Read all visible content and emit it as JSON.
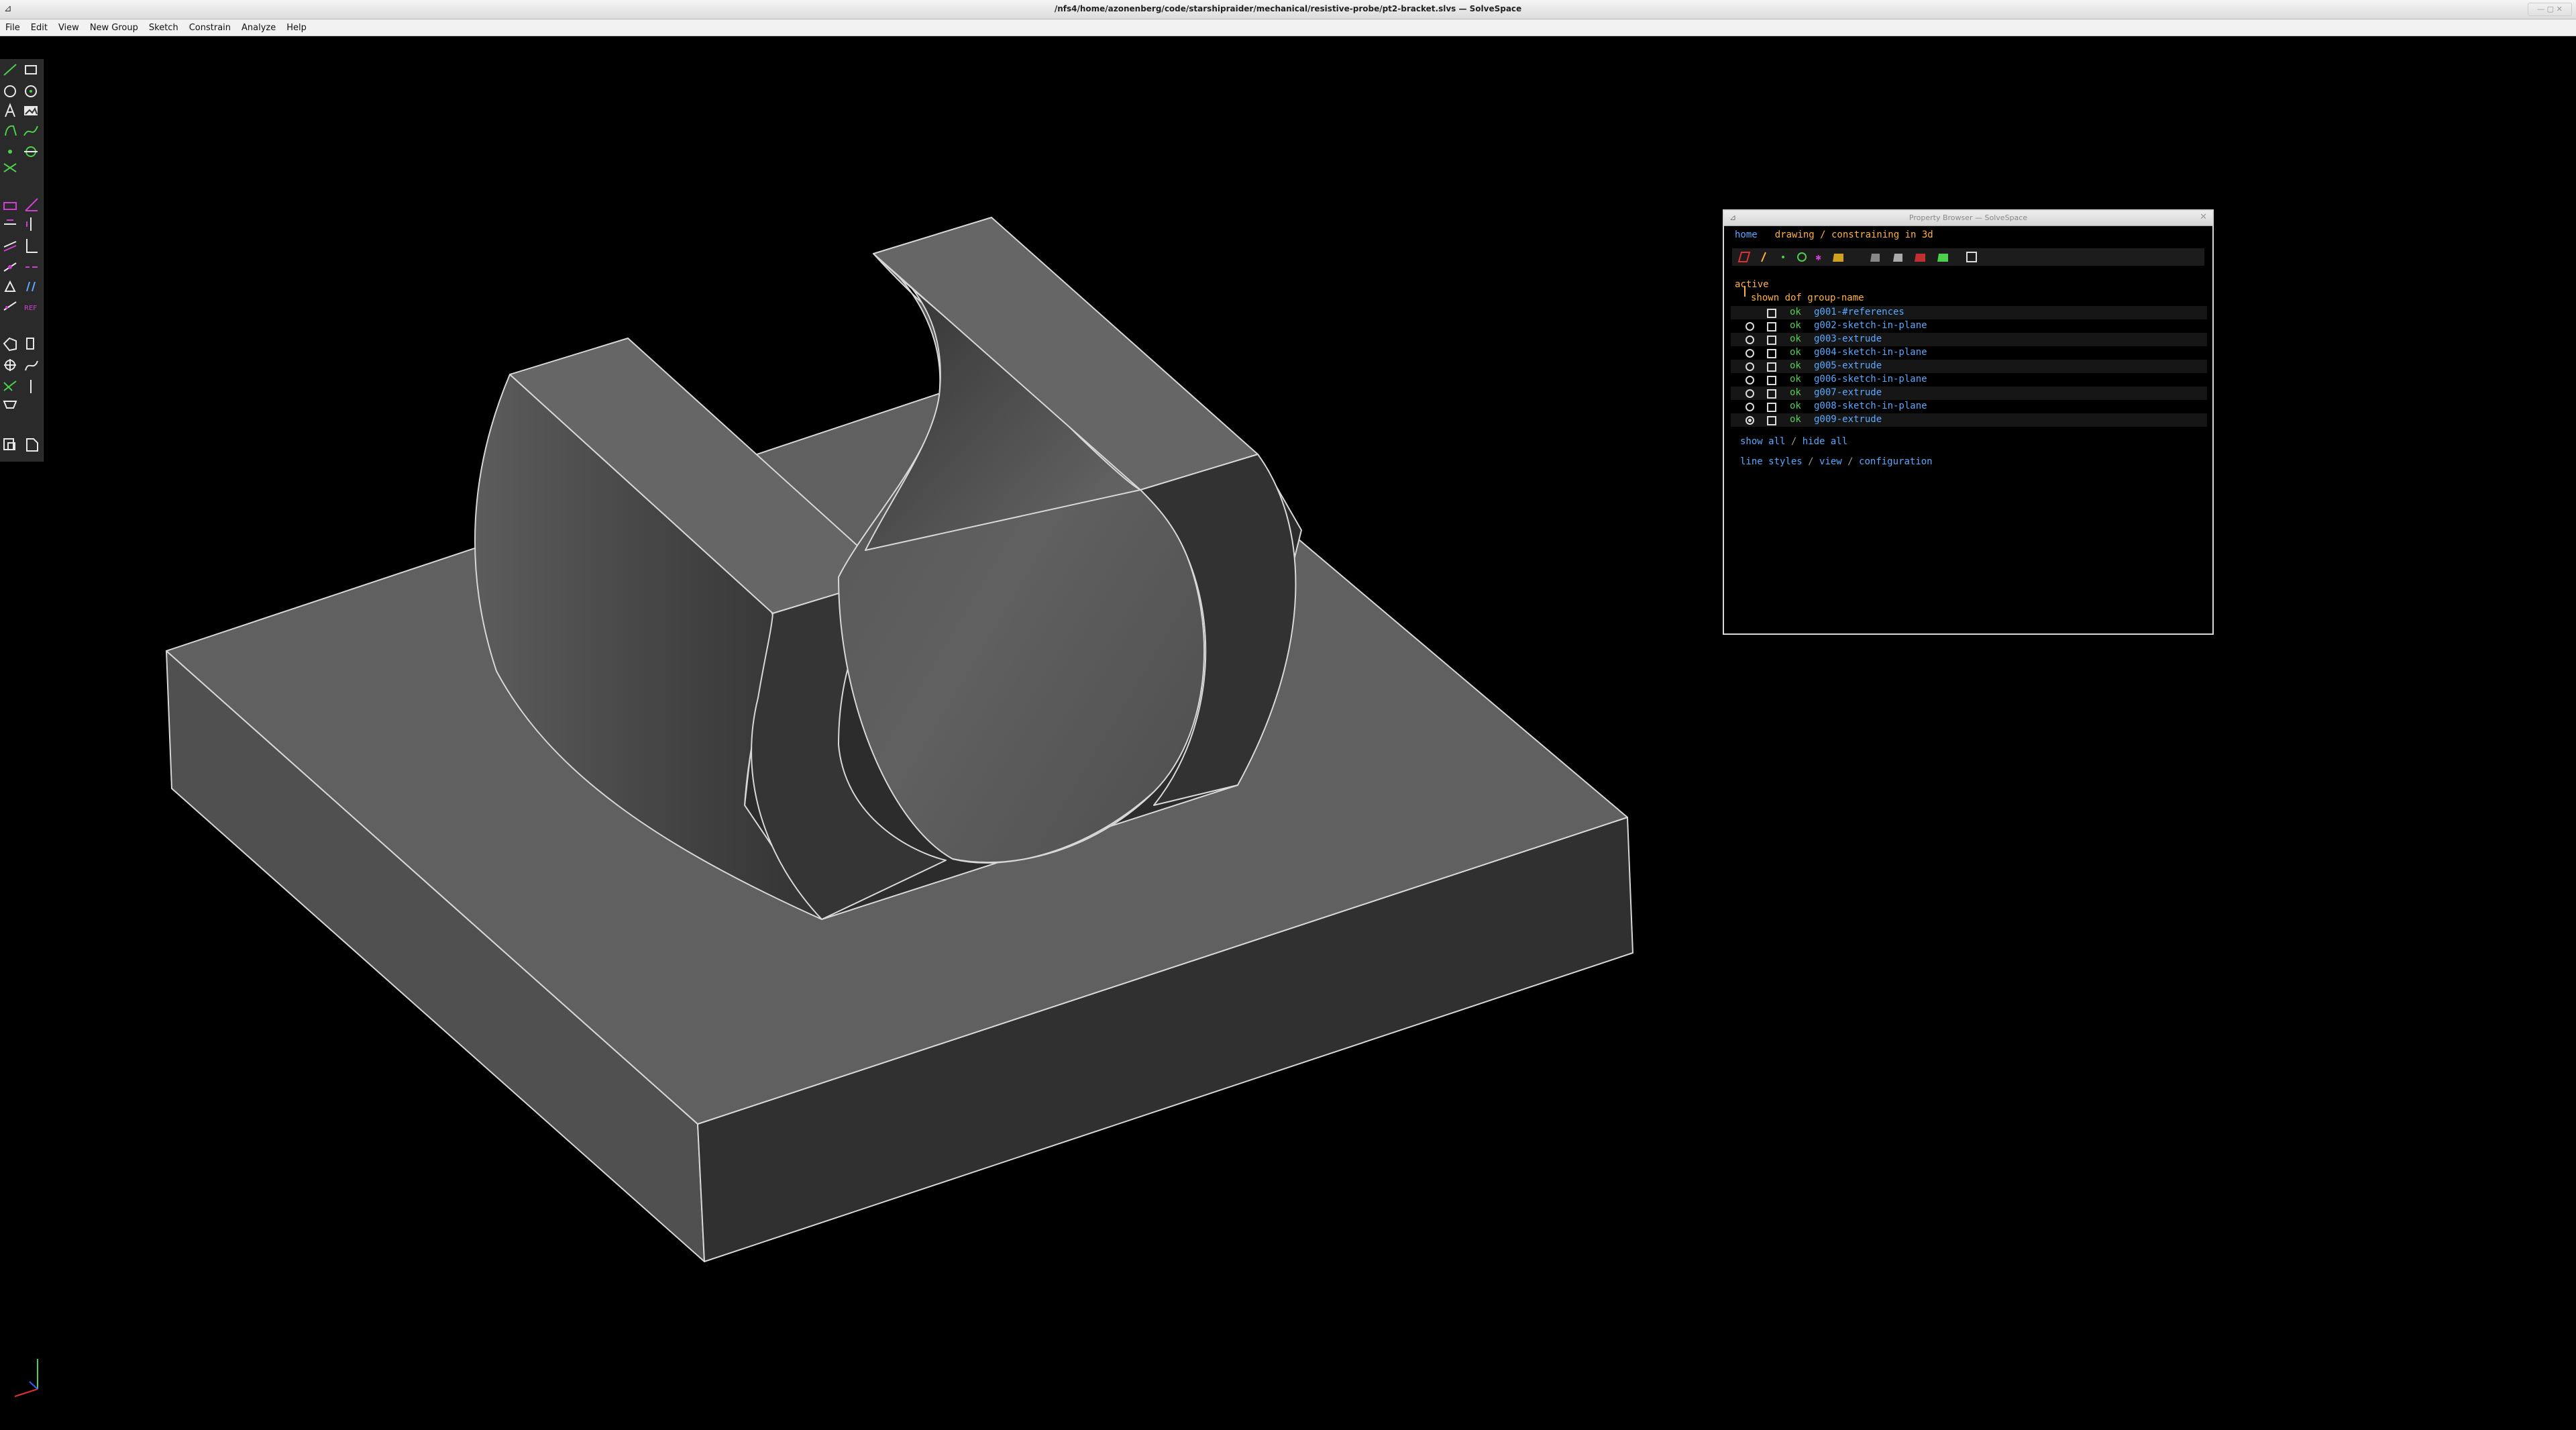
{
  "window": {
    "title": "/nfs4/home/azonenberg/code/starshipraider/mechanical/resistive-probe/pt2-bracket.slvs — SolveSpace"
  },
  "menu": [
    "File",
    "Edit",
    "View",
    "New Group",
    "Sketch",
    "Constrain",
    "Analyze",
    "Help"
  ],
  "toolbar": {
    "tools": [
      "line-tool-icon",
      "rectangle-tool-icon",
      "circle-tool-icon",
      "arc-tool-icon",
      "text-tool-icon",
      "image-tool-icon",
      "tangent-arc-icon",
      "bezier-spline-icon",
      "point-tool-icon",
      "workplane-icon",
      "split-curves-icon",
      "distance-constraint-icon",
      "angle-constraint-icon",
      "horizontal-constraint-icon",
      "vertical-constraint-icon",
      "parallel-constraint-icon",
      "perpendicular-constraint-icon",
      "point-on-line-icon",
      "symmetric-constraint-icon",
      "equal-constraint-icon",
      "ref-dimension-icon",
      "extrude-icon",
      "lathe-icon",
      "step-rotating-icon",
      "step-translating-icon",
      "helix-icon",
      "revolve-icon",
      "workplane-group-icon",
      "sketch-in-3d-icon"
    ],
    "colors": {
      "green": "#4cd04c",
      "magenta": "#d040d0",
      "white": "#e8e8e8"
    }
  },
  "browser": {
    "title": "Property Browser — SolveSpace",
    "home_label": "home",
    "breadcrumb": "drawing / constraining in 3d",
    "section": "active",
    "columns": "shown dof group-name",
    "groups": [
      {
        "status": "ok",
        "name": "g001-#references",
        "has_radio": false,
        "active": false
      },
      {
        "status": "ok",
        "name": "g002-sketch-in-plane",
        "has_radio": true,
        "active": false
      },
      {
        "status": "ok",
        "name": "g003-extrude",
        "has_radio": true,
        "active": false
      },
      {
        "status": "ok",
        "name": "g004-sketch-in-plane",
        "has_radio": true,
        "active": false
      },
      {
        "status": "ok",
        "name": "g005-extrude",
        "has_radio": true,
        "active": false
      },
      {
        "status": "ok",
        "name": "g006-sketch-in-plane",
        "has_radio": true,
        "active": false
      },
      {
        "status": "ok",
        "name": "g007-extrude",
        "has_radio": true,
        "active": false
      },
      {
        "status": "ok",
        "name": "g008-sketch-in-plane",
        "has_radio": true,
        "active": false
      },
      {
        "status": "ok",
        "name": "g009-extrude",
        "has_radio": true,
        "active": true
      }
    ],
    "show_all": "show all",
    "hide_all": "hide all",
    "link_sep": " / ",
    "line_styles": "line styles",
    "view": "view",
    "configuration": "configuration"
  },
  "colors": {
    "background": "#000000",
    "link": "#5aa8ff",
    "label": "#ffb040",
    "ok": "#52d252",
    "edge": "#d8d8d8"
  }
}
